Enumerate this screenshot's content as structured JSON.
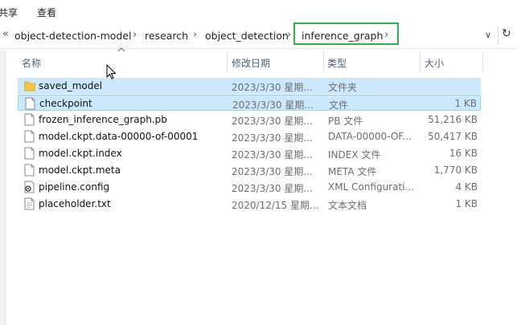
{
  "ribbon": {
    "tabs": [
      "共享",
      "查看"
    ]
  },
  "address": {
    "overflow": "«",
    "crumbs": [
      "object-detection-model",
      "research",
      "object_detection",
      "inference_graph"
    ],
    "sep": "›",
    "dropdown": "∨",
    "refresh": "↻"
  },
  "columns": {
    "name": "名称",
    "date": "修改日期",
    "type": "类型",
    "size": "大小"
  },
  "files": [
    {
      "name": "saved_model",
      "date": "2023/3/30 星期...",
      "type": "文件夹",
      "size": "",
      "icon": "folder-icon"
    },
    {
      "name": "checkpoint",
      "date": "2023/3/30 星期...",
      "type": "文件",
      "size": "1 KB",
      "icon": "file-icon"
    },
    {
      "name": "frozen_inference_graph.pb",
      "date": "2023/3/30 星期...",
      "type": "PB 文件",
      "size": "51,216 KB",
      "icon": "file-icon"
    },
    {
      "name": "model.ckpt.data-00000-of-00001",
      "date": "2023/3/30 星期...",
      "type": "DATA-00000-OF...",
      "size": "50,417 KB",
      "icon": "file-icon"
    },
    {
      "name": "model.ckpt.index",
      "date": "2023/3/30 星期...",
      "type": "INDEX 文件",
      "size": "16 KB",
      "icon": "file-icon"
    },
    {
      "name": "model.ckpt.meta",
      "date": "2023/3/30 星期...",
      "type": "META 文件",
      "size": "1,770 KB",
      "icon": "file-icon"
    },
    {
      "name": "pipeline.config",
      "date": "2023/3/30 星期...",
      "type": "XML Configurati...",
      "size": "4 KB",
      "icon": "config-file-icon"
    },
    {
      "name": "placeholder.txt",
      "date": "2020/12/15 星期...",
      "type": "文本文档",
      "size": "1 KB",
      "icon": "text-file-icon"
    }
  ],
  "colors": {
    "selection": "#cce8ff",
    "selection_border": "#99d1ff",
    "highlight": "#2eb34a",
    "header_text": "#4d6082",
    "folder": "#f5c543"
  }
}
